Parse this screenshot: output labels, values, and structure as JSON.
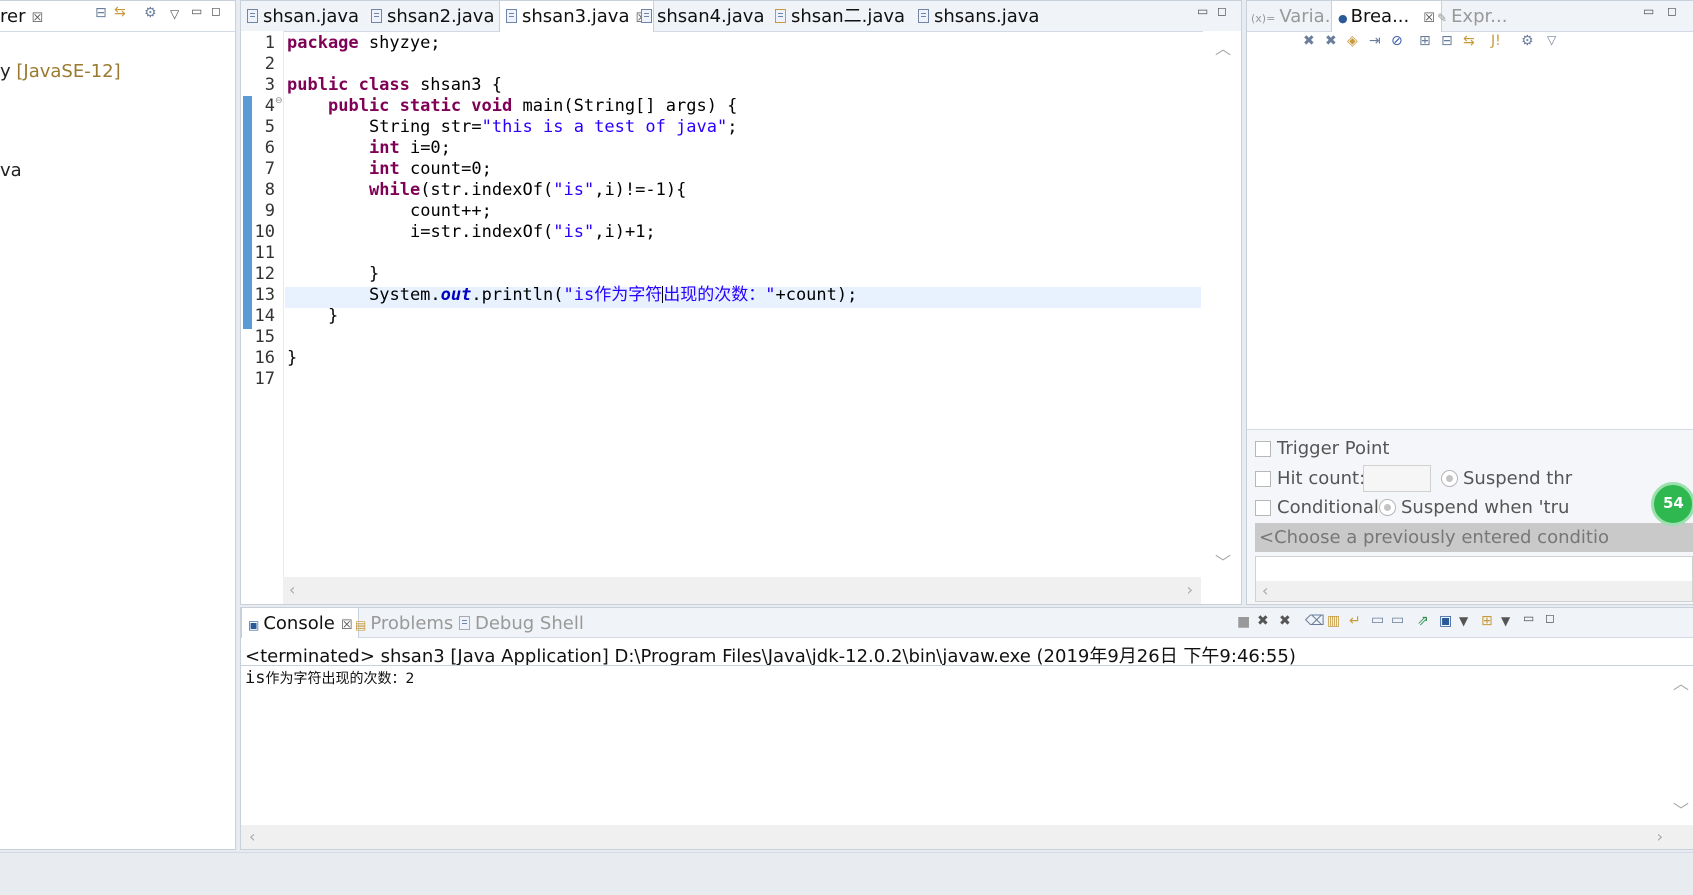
{
  "left_panel": {
    "tab_label": "rer",
    "tree_items": [
      "y",
      "[JavaSE-12]",
      "va"
    ]
  },
  "editor": {
    "tabs": [
      {
        "label": "shsan.java",
        "active": false
      },
      {
        "label": "shsan2.java",
        "active": false
      },
      {
        "label": "shsan3.java",
        "active": true
      },
      {
        "label": "shsan4.java",
        "active": false
      },
      {
        "label": "shsan二.java",
        "active": false
      },
      {
        "label": "shsans.java",
        "active": false
      }
    ],
    "current_line": 13,
    "lines": [
      {
        "n": "1"
      },
      {
        "n": "2"
      },
      {
        "n": "3"
      },
      {
        "n": "4"
      },
      {
        "n": "5"
      },
      {
        "n": "6"
      },
      {
        "n": "7"
      },
      {
        "n": "8"
      },
      {
        "n": "9"
      },
      {
        "n": "10"
      },
      {
        "n": "11"
      },
      {
        "n": "12"
      },
      {
        "n": "13"
      },
      {
        "n": "14"
      },
      {
        "n": "15"
      },
      {
        "n": "16"
      },
      {
        "n": "17"
      }
    ],
    "code": {
      "l1_kw": "package",
      "l1_rest": " shyzye;",
      "l3_kw": "public class",
      "l3_rest": " shsan3 {",
      "l4_kw": "public static void",
      "l4_rest": " main(String[] args) {",
      "l5_a": "String str=",
      "l5_str": "\"this is a test of java\"",
      "l5_b": ";",
      "l6_kw": "int",
      "l6_rest": " i=0;",
      "l7_kw": "int",
      "l7_rest": " count=0;",
      "l8_kw": "while",
      "l8_a": "(str.indexOf(",
      "l8_str": "\"is\"",
      "l8_b": ",i)!=-1){",
      "l9": "count++;",
      "l10_a": "i=str.indexOf(",
      "l10_str": "\"is\"",
      "l10_b": ",i)+1;",
      "l12": "}",
      "l13_a": "System.",
      "l13_field": "out",
      "l13_b": ".println(",
      "l13_str1": "\"is作为字符",
      "l13_str2": "出现的次数：\"",
      "l13_c": "+count);",
      "l14": "}",
      "l16": "}"
    }
  },
  "right_panel": {
    "tabs": [
      "Varia...",
      "Brea...",
      "Expr..."
    ],
    "trigger_point": "Trigger Point",
    "hit_count": "Hit count:",
    "suspend_thread": "Suspend thr",
    "conditional": "Conditional",
    "suspend_when": "Suspend when 'tru",
    "condition_placeholder": "<Choose a previously entered conditio",
    "badge": "54"
  },
  "console": {
    "tabs": [
      "Console",
      "Problems",
      "Debug Shell"
    ],
    "header": "<terminated> shsan3 [Java Application] D:\\Program Files\\Java\\jdk-12.0.2\\bin\\javaw.exe (2019年9月26日 下午9:46:55)",
    "output_prefix": "is",
    "output_rest": "作为字符出现的次数：2"
  }
}
